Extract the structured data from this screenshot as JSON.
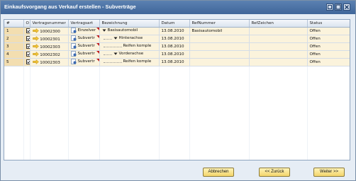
{
  "window": {
    "title": "Einkaufsvorgang aus Verkauf erstellen - Subverträge"
  },
  "grid": {
    "columns": [
      "#",
      "O",
      "Vertragsnummer",
      "Vertragsart",
      "Bezeichnung",
      "Datum",
      "RefNummer",
      "RefZeichen",
      "Status"
    ],
    "rows": [
      {
        "num": "1",
        "checked": true,
        "vertragsnummer": "10002300",
        "vertragsart": "Einzelver",
        "bezeichnung": "Basisautomobil",
        "level": 0,
        "expanded": true,
        "datum": "13.08.2010",
        "refnummer": "Basisautomobil",
        "refzeichen": "",
        "status": "Offen"
      },
      {
        "num": "2",
        "checked": true,
        "vertragsnummer": "10002301",
        "vertragsart": "Subvertr",
        "bezeichnung": "Hinterachse",
        "level": 1,
        "expanded": true,
        "datum": "13.08.2010",
        "refnummer": "",
        "refzeichen": "",
        "status": "Offen"
      },
      {
        "num": "3",
        "checked": true,
        "vertragsnummer": "10002303",
        "vertragsart": "Subvertr",
        "bezeichnung": "Reifen komple",
        "level": 2,
        "expanded": false,
        "datum": "13.08.2010",
        "refnummer": "",
        "refzeichen": "",
        "status": "Offen"
      },
      {
        "num": "4",
        "checked": true,
        "vertragsnummer": "10002302",
        "vertragsart": "Subvertr",
        "bezeichnung": "Vorderachse",
        "level": 1,
        "expanded": true,
        "datum": "13.08.2010",
        "refnummer": "",
        "refzeichen": "",
        "status": "Offen"
      },
      {
        "num": "5",
        "checked": true,
        "vertragsnummer": "10002303",
        "vertragsart": "Subvertr",
        "bezeichnung": "Reifen komple",
        "level": 2,
        "expanded": false,
        "datum": "13.08.2010",
        "refnummer": "",
        "refzeichen": "",
        "status": "Offen"
      }
    ]
  },
  "buttons": {
    "abbrechen": "Abbrechen",
    "zurueck": "<< Zurück",
    "weiter": "Weiter >>"
  },
  "colors": {
    "titlebar": "#4a73a6",
    "row_bg": "#fbf3dc",
    "button_bg": "#f6dc7a",
    "marker": "#c21d1d",
    "arrow": "#e8b21b"
  }
}
